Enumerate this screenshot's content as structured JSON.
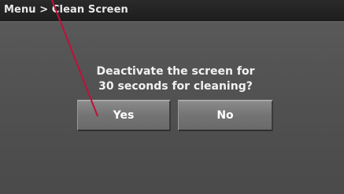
{
  "header": {
    "breadcrumb": "Menu > Clean Screen"
  },
  "dialog": {
    "prompt_line1": "Deactivate the screen for",
    "prompt_line2": "30 seconds for cleaning?",
    "yes_label": "Yes",
    "no_label": "No"
  },
  "colors": {
    "pointer": "#c0103a"
  }
}
